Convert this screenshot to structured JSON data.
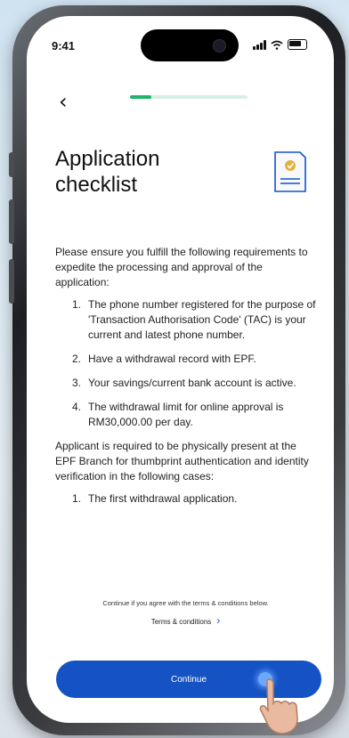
{
  "status_bar": {
    "time": "9:41"
  },
  "nav": {
    "back_label": "‹",
    "progress_fraction": 0.18
  },
  "header": {
    "title": "Application checklist",
    "icon": "document-check-icon"
  },
  "intro": "Please ensure you fulfill the following requirements to expedite the processing and approval of the application:",
  "requirements": [
    {
      "num": "1.",
      "text": "The phone number registered for the purpose of 'Transaction Authorisation Code' (TAC) is your current and latest phone number."
    },
    {
      "num": "2.",
      "text": "Have a withdrawal record with EPF."
    },
    {
      "num": "3.",
      "text": "Your savings/current bank account is active."
    },
    {
      "num": "4.",
      "text": "The withdrawal limit for online approval is RM30,000.00 per day."
    }
  ],
  "presence_note": "Applicant is required to be physically present at the EPF Branch for thumbprint authentication and identity verification in the following cases:",
  "presence_cases": [
    {
      "num": "1.",
      "text": "The first withdrawal application."
    }
  ],
  "footer": {
    "fine_print": "Continue if you agree with the terms & conditions below.",
    "terms_label": "Terms & conditions",
    "continue_label": "Continue"
  },
  "colors": {
    "primary": "#1553c4",
    "progress": "#1fb46b",
    "icon_accent": "#e0b43a"
  }
}
